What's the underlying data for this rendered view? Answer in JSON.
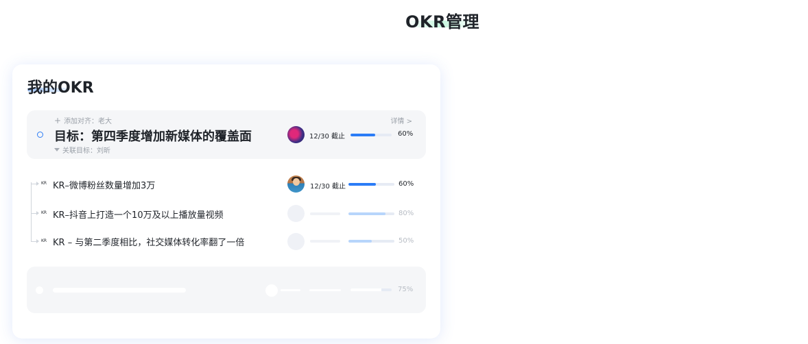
{
  "page_title": "OKR管理",
  "card": {
    "title": "我的OKR",
    "objective": {
      "align_label": "添加对齐：老大",
      "detail_link": "详情 >",
      "title": "目标：第四季度增加新媒体的覆盖面",
      "linked_label": "关联目标：刘昕",
      "due": "12/30 截止",
      "progress": 0.6,
      "progress_label": "60%"
    },
    "key_results": [
      {
        "tag": "KR",
        "text": "KR–微博粉丝数量增加3万",
        "due": "12/30 截止",
        "progress": 0.6,
        "progress_label": "60%",
        "active": true
      },
      {
        "tag": "KR",
        "text": "KR–抖音上打造一个10万及以上播放量视频",
        "progress": 0.8,
        "progress_label": "80%",
        "active": false
      },
      {
        "tag": "KR",
        "text": "KR – 与第二季度相比，社交媒体转化率翻了一倍",
        "progress": 0.5,
        "progress_label": "50%",
        "active": false
      }
    ],
    "placeholder_objective": {
      "progress": 0.75,
      "progress_label": "75%"
    }
  },
  "colors": {
    "accent": "#2b7cf6",
    "accent_light": "#b7d5fb",
    "track": "#e6ebf4",
    "panel": "#f5f6f8"
  }
}
